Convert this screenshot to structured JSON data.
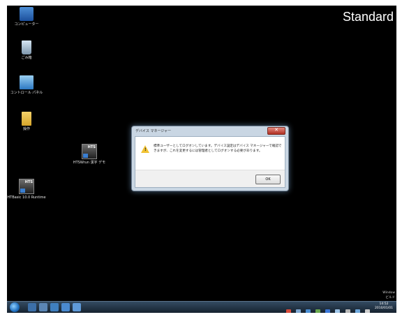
{
  "watermark": "Standard",
  "desktop_icons": [
    {
      "label": "コンピューター"
    },
    {
      "label": "ごみ箱"
    },
    {
      "label": "コントロール パネル"
    },
    {
      "label": "操作"
    },
    {
      "label": "HTSWrun 漢字 デモ"
    },
    {
      "label": "HTBasic 10.0 Runtime"
    }
  ],
  "dialog": {
    "title": "デバイス マネージャー",
    "close_symbol": "✕",
    "message": "標準ユーザーとしてログオンしています。デバイス設定はデバイス マネージャーで確認できますが、これを変更するには管理者としてログオンする必要があります。",
    "ok_label": "OK"
  },
  "windows_info": {
    "line1": "Window",
    "line2": "ビルド"
  },
  "clock": {
    "time": "14:52",
    "date": "2010/01/01"
  },
  "colors": {
    "desktop": "#000000",
    "taskbar": "#1f2f40",
    "dialog_frame": "#c9d6e3",
    "close_button": "#c0392b"
  }
}
